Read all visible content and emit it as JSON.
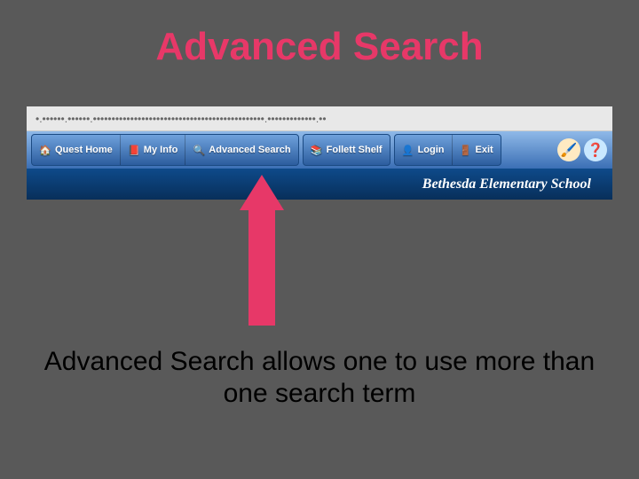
{
  "title": "Advanced Search",
  "url_bar": "•.••••••.••••••.••••••••••••••••••••••••••••••••••••••••••••••.•••••••••••••.••",
  "nav": {
    "group1": [
      {
        "icon": "home-icon",
        "glyph": "🏠",
        "label": "Quest Home"
      },
      {
        "icon": "info-icon",
        "glyph": "📕",
        "label": "My Info"
      },
      {
        "icon": "search-icon",
        "glyph": "🔍",
        "label": "Advanced Search"
      }
    ],
    "group2": [
      {
        "icon": "shelf-icon",
        "glyph": "📚",
        "label": "Follett Shelf"
      }
    ],
    "group3": [
      {
        "icon": "login-icon",
        "glyph": "👤",
        "label": "Login"
      },
      {
        "icon": "exit-icon",
        "glyph": "🚪",
        "label": "Exit"
      }
    ],
    "tools": [
      {
        "name": "paint-icon",
        "glyph": "🖌️",
        "bg": "#ffeac2"
      },
      {
        "name": "help-icon",
        "glyph": "❓",
        "bg": "#c9e8ff"
      }
    ]
  },
  "banner": "Bethesda Elementary School",
  "caption": "Advanced Search allows one to use more than one search term"
}
